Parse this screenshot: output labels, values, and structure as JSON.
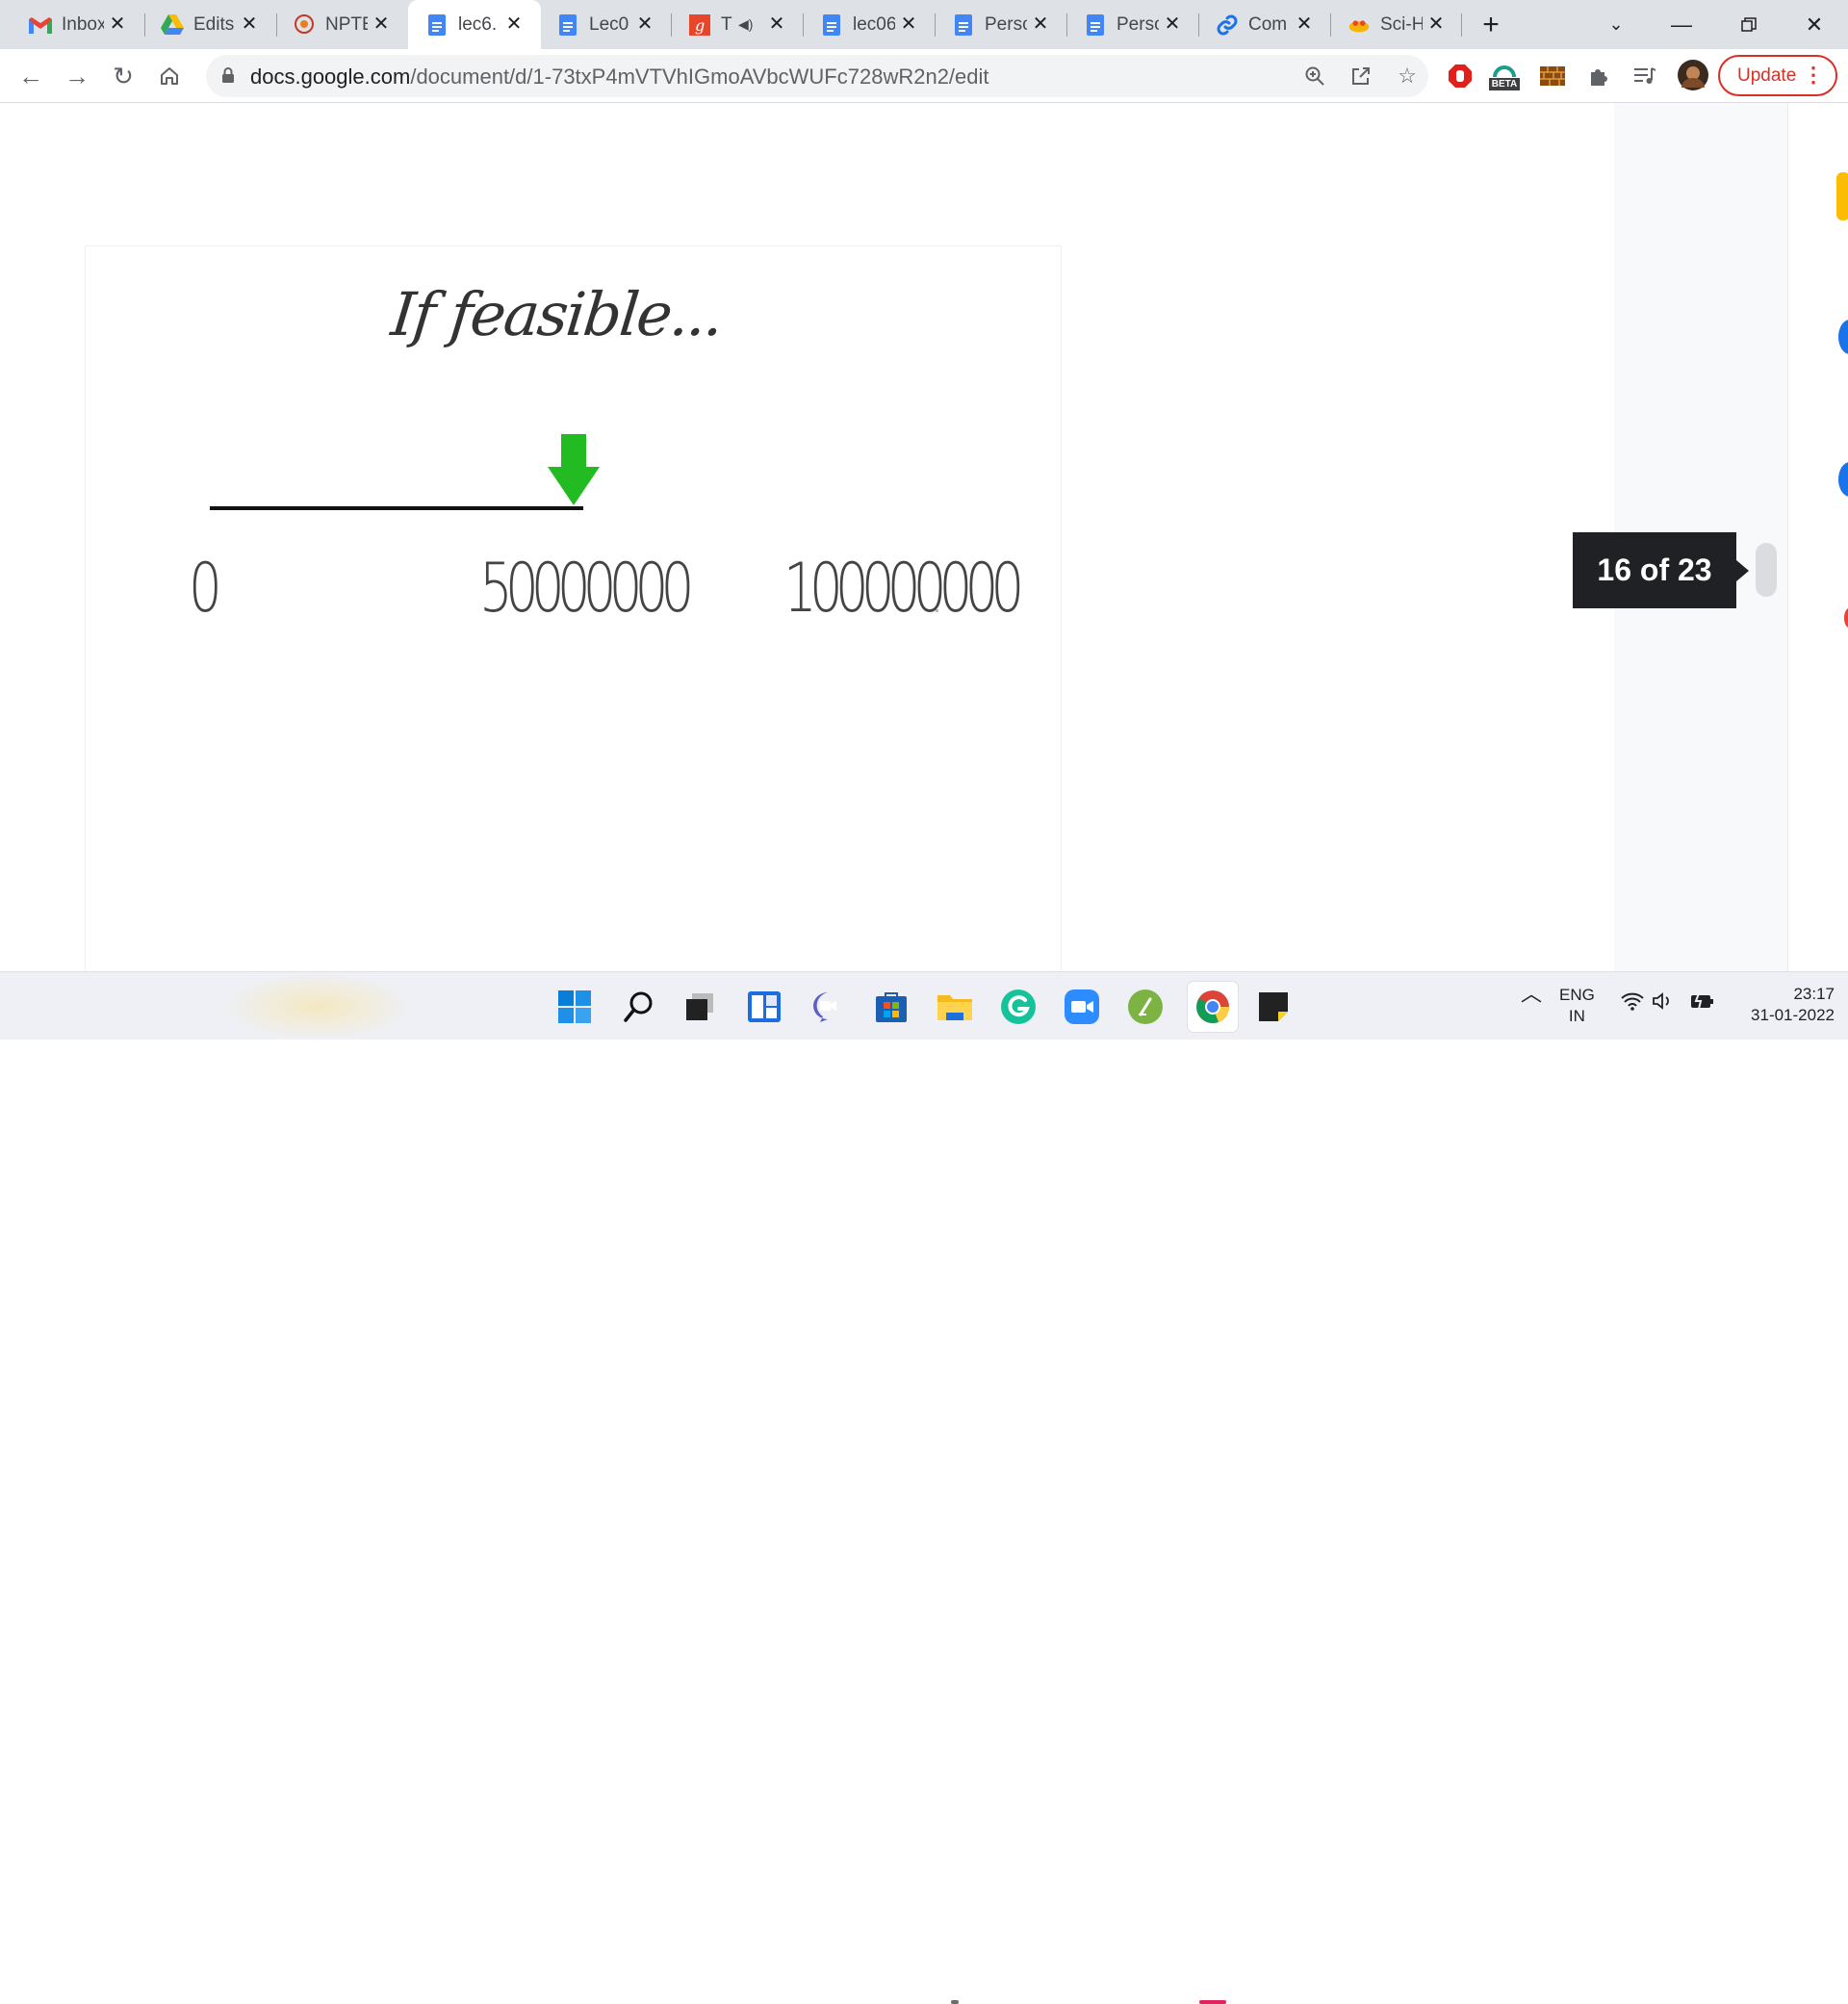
{
  "browser": {
    "tabs": [
      {
        "label": "Inbox",
        "icon": "gmail-icon"
      },
      {
        "label": "Edits",
        "icon": "google-drive-icon"
      },
      {
        "label": "NPTE",
        "icon": "nptel-icon"
      },
      {
        "label": "lec6.",
        "icon": "google-docs-icon",
        "active": true
      },
      {
        "label": "Lec0",
        "icon": "google-docs-icon"
      },
      {
        "label": "T",
        "icon": "grammarly-g-icon",
        "audio": true
      },
      {
        "label": "lec06",
        "icon": "google-docs-icon"
      },
      {
        "label": "Perso",
        "icon": "google-docs-icon"
      },
      {
        "label": "Perso",
        "icon": "google-docs-icon"
      },
      {
        "label": "Com",
        "icon": "link-icon"
      },
      {
        "label": "Sci-H",
        "icon": "sci-hub-icon"
      }
    ],
    "address": {
      "host": "docs.google.com",
      "path": "/document/d/1-73txP4mVTVhIGmoAVbcWUFc728wR2n2/edit"
    },
    "update_label": "Update",
    "extension_badge": "BETA"
  },
  "slide": {
    "title": "If feasible...",
    "labels": [
      "0",
      "50000000",
      "100000000"
    ],
    "arrow_color": "#22bb22"
  },
  "page_indicator": "16 of 23",
  "taskbar": {
    "language": "ENG",
    "region": "IN",
    "time": "23:17",
    "date": "31-01-2022"
  },
  "colors": {
    "accent_red": "#d93025",
    "docs_blue": "#4285f4"
  }
}
